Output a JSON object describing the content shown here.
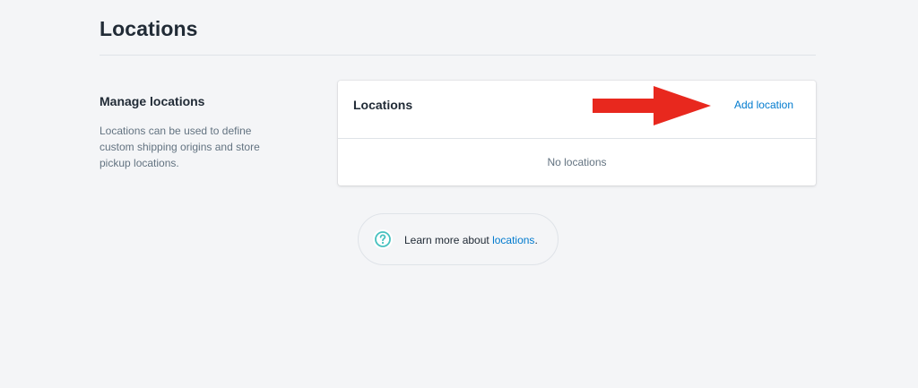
{
  "page": {
    "title": "Locations"
  },
  "section": {
    "title": "Manage locations",
    "description": "Locations can be used to define custom shipping origins and store pickup locations."
  },
  "card": {
    "title": "Locations",
    "add_label": "Add location",
    "empty_text": "No locations"
  },
  "footer": {
    "prefix": "Learn more about ",
    "link_label": "locations",
    "suffix": "."
  },
  "icons": {
    "help": "question-circle-icon",
    "annotation": "red-arrow-icon"
  },
  "colors": {
    "background": "#f4f5f7",
    "link": "#007ace",
    "help_icon": "#47c1bf",
    "arrow": "#e8281e"
  }
}
